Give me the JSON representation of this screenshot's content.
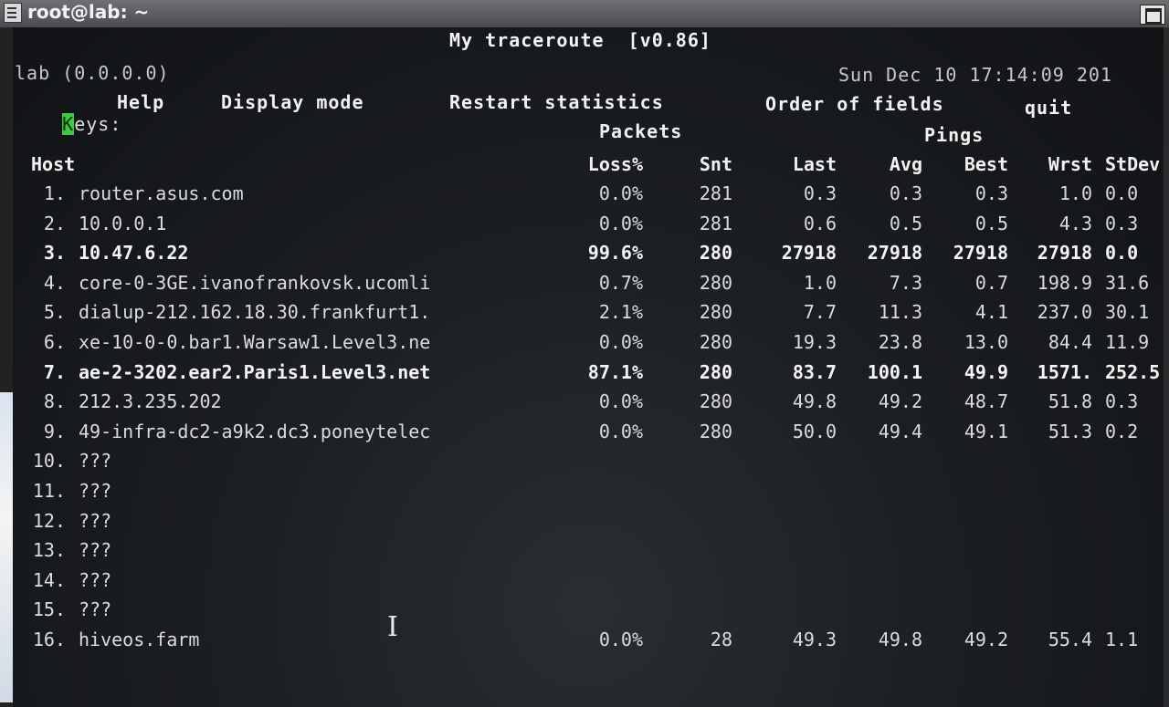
{
  "window": {
    "title": "root@lab: ~"
  },
  "header": {
    "title": "My traceroute  [v0.86]",
    "host": "lab (0.0.0.0)",
    "datetime": "Sun Dec 10 17:14:09 201"
  },
  "keys": {
    "label_cursor": "K",
    "label_rest": "eys:",
    "help": "Help",
    "display_mode": "Display mode",
    "restart": "Restart statistics",
    "order": "Order of fields",
    "quit": "quit"
  },
  "columns": {
    "packets": "Packets",
    "pings": "Pings",
    "host": "Host",
    "loss": "Loss%",
    "snt": "Snt",
    "last": "Last",
    "avg": "Avg",
    "best": "Best",
    "wrst": "Wrst",
    "stdev": "StDev"
  },
  "hops": [
    {
      "num": "1.",
      "host": "router.asus.com",
      "loss": "0.0%",
      "snt": "281",
      "last": "0.3",
      "avg": "0.3",
      "best": "0.3",
      "wrst": "1.0",
      "stdev": "0.0"
    },
    {
      "num": "2.",
      "host": "10.0.0.1",
      "loss": "0.0%",
      "snt": "281",
      "last": "0.6",
      "avg": "0.5",
      "best": "0.5",
      "wrst": "4.3",
      "stdev": "0.3"
    },
    {
      "num": "3.",
      "host": "10.47.6.22",
      "loss": "99.6%",
      "snt": "280",
      "last": "27918",
      "avg": "27918",
      "best": "27918",
      "wrst": "27918",
      "stdev": "0.0"
    },
    {
      "num": "4.",
      "host": "core-0-3GE.ivanofrankovsk.ucomli",
      "loss": "0.7%",
      "snt": "280",
      "last": "1.0",
      "avg": "7.3",
      "best": "0.7",
      "wrst": "198.9",
      "stdev": "31.6"
    },
    {
      "num": "5.",
      "host": "dialup-212.162.18.30.frankfurt1.",
      "loss": "2.1%",
      "snt": "280",
      "last": "7.7",
      "avg": "11.3",
      "best": "4.1",
      "wrst": "237.0",
      "stdev": "30.1"
    },
    {
      "num": "6.",
      "host": "xe-10-0-0.bar1.Warsaw1.Level3.ne",
      "loss": "0.0%",
      "snt": "280",
      "last": "19.3",
      "avg": "23.8",
      "best": "13.0",
      "wrst": "84.4",
      "stdev": "11.9"
    },
    {
      "num": "7.",
      "host": "ae-2-3202.ear2.Paris1.Level3.net",
      "loss": "87.1%",
      "snt": "280",
      "last": "83.7",
      "avg": "100.1",
      "best": "49.9",
      "wrst": "1571.",
      "stdev": "252.5"
    },
    {
      "num": "8.",
      "host": "212.3.235.202",
      "loss": "0.0%",
      "snt": "280",
      "last": "49.8",
      "avg": "49.2",
      "best": "48.7",
      "wrst": "51.8",
      "stdev": "0.3"
    },
    {
      "num": "9.",
      "host": "49-infra-dc2-a9k2.dc3.poneytelec",
      "loss": "0.0%",
      "snt": "280",
      "last": "50.0",
      "avg": "49.4",
      "best": "49.1",
      "wrst": "51.3",
      "stdev": "0.2"
    },
    {
      "num": "10.",
      "host": "???",
      "loss": "",
      "snt": "",
      "last": "",
      "avg": "",
      "best": "",
      "wrst": "",
      "stdev": ""
    },
    {
      "num": "11.",
      "host": "???",
      "loss": "",
      "snt": "",
      "last": "",
      "avg": "",
      "best": "",
      "wrst": "",
      "stdev": ""
    },
    {
      "num": "12.",
      "host": "???",
      "loss": "",
      "snt": "",
      "last": "",
      "avg": "",
      "best": "",
      "wrst": "",
      "stdev": ""
    },
    {
      "num": "13.",
      "host": "???",
      "loss": "",
      "snt": "",
      "last": "",
      "avg": "",
      "best": "",
      "wrst": "",
      "stdev": ""
    },
    {
      "num": "14.",
      "host": "???",
      "loss": "",
      "snt": "",
      "last": "",
      "avg": "",
      "best": "",
      "wrst": "",
      "stdev": ""
    },
    {
      "num": "15.",
      "host": "???",
      "loss": "",
      "snt": "",
      "last": "",
      "avg": "",
      "best": "",
      "wrst": "",
      "stdev": ""
    },
    {
      "num": "16.",
      "host": "hiveos.farm",
      "loss": "0.0%",
      "snt": "28",
      "last": "49.3",
      "avg": "49.8",
      "best": "49.2",
      "wrst": "55.4",
      "stdev": "1.1"
    }
  ],
  "colors": {
    "background": "#1b1e22",
    "text": "#dcdcdc",
    "cursor": "#3ec93e"
  }
}
